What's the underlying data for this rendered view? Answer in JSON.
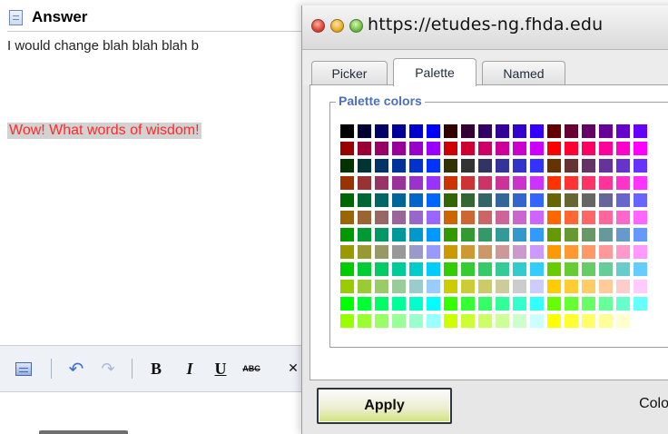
{
  "editor": {
    "title": "Answer",
    "text_line_1": "I would change blah blah blah b",
    "text_line_2": "Wow! What words of wisdom!",
    "toolbar": {
      "source_icon": "source-icon",
      "undo_icon": "undo-icon",
      "redo_icon": "redo-icon",
      "bold_label": "B",
      "italic_label": "I",
      "underline_label": "U",
      "strike_label": "ABC",
      "remove_label": "✕"
    }
  },
  "popup": {
    "url": "https://etudes-ng.fhda.edu",
    "tabs": [
      {
        "label": "Picker",
        "active": false
      },
      {
        "label": "Palette",
        "active": true
      },
      {
        "label": "Named",
        "active": false
      }
    ],
    "section_title": "Palette colors",
    "apply_label": "Apply",
    "color_label": "Colo"
  },
  "palette_colors": [
    [
      "#000000",
      "#000033",
      "#000066",
      "#000099",
      "#0000cc",
      "#0000ff",
      "#330000",
      "#330033",
      "#330066",
      "#330099",
      "#3300cc",
      "#3300ff",
      "#660000",
      "#660033",
      "#660066",
      "#660099",
      "#6600cc",
      "#6600ff"
    ],
    [
      "#990000",
      "#990033",
      "#990066",
      "#990099",
      "#9900cc",
      "#9900ff",
      "#cc0000",
      "#cc0033",
      "#cc0066",
      "#cc0099",
      "#cc00cc",
      "#cc00ff",
      "#ff0000",
      "#ff0033",
      "#ff0066",
      "#ff0099",
      "#ff00cc",
      "#ff00ff"
    ],
    [
      "#003300",
      "#003333",
      "#003366",
      "#003399",
      "#0033cc",
      "#0033ff",
      "#333300",
      "#333333",
      "#333366",
      "#333399",
      "#3333cc",
      "#3333ff",
      "#663300",
      "#663333",
      "#663366",
      "#663399",
      "#6633cc",
      "#6633ff"
    ],
    [
      "#993300",
      "#993333",
      "#993366",
      "#993399",
      "#9933cc",
      "#9933ff",
      "#cc3300",
      "#cc3333",
      "#cc3366",
      "#cc3399",
      "#cc33cc",
      "#cc33ff",
      "#ff3300",
      "#ff3333",
      "#ff3366",
      "#ff3399",
      "#ff33cc",
      "#ff33ff"
    ],
    [
      "#006600",
      "#006633",
      "#006666",
      "#006699",
      "#0066cc",
      "#0066ff",
      "#336600",
      "#336633",
      "#336666",
      "#336699",
      "#3366cc",
      "#3366ff",
      "#666600",
      "#666633",
      "#666666",
      "#666699",
      "#6666cc",
      "#6666ff"
    ],
    [
      "#996600",
      "#996633",
      "#996666",
      "#996699",
      "#9966cc",
      "#9966ff",
      "#cc6600",
      "#cc6633",
      "#cc6666",
      "#cc6699",
      "#cc66cc",
      "#cc66ff",
      "#ff6600",
      "#ff6633",
      "#ff6666",
      "#ff6699",
      "#ff66cc",
      "#ff66ff"
    ],
    [
      "#009900",
      "#009933",
      "#009966",
      "#009999",
      "#0099cc",
      "#0099ff",
      "#339900",
      "#339933",
      "#339966",
      "#339999",
      "#3399cc",
      "#3399ff",
      "#669900",
      "#669933",
      "#669966",
      "#669999",
      "#6699cc",
      "#6699ff"
    ],
    [
      "#999900",
      "#999933",
      "#999966",
      "#999999",
      "#9999cc",
      "#9999ff",
      "#cc9900",
      "#cc9933",
      "#cc9966",
      "#cc9999",
      "#cc99cc",
      "#cc99ff",
      "#ff9900",
      "#ff9933",
      "#ff9966",
      "#ff9999",
      "#ff99cc",
      "#ff99ff"
    ],
    [
      "#00cc00",
      "#00cc33",
      "#00cc66",
      "#00cc99",
      "#00cccc",
      "#00ccff",
      "#33cc00",
      "#33cc33",
      "#33cc66",
      "#33cc99",
      "#33cccc",
      "#33ccff",
      "#66cc00",
      "#66cc33",
      "#66cc66",
      "#66cc99",
      "#66cccc",
      "#66ccff"
    ],
    [
      "#99cc00",
      "#99cc33",
      "#99cc66",
      "#99cc99",
      "#99cccc",
      "#99ccff",
      "#cccc00",
      "#cccc33",
      "#cccc66",
      "#cccc99",
      "#cccccc",
      "#ccccff",
      "#ffcc00",
      "#ffcc33",
      "#ffcc66",
      "#ffcc99",
      "#ffcccc",
      "#ffccff"
    ],
    [
      "#00ff00",
      "#00ff33",
      "#00ff66",
      "#00ff99",
      "#00ffcc",
      "#00ffff",
      "#33ff00",
      "#33ff33",
      "#33ff66",
      "#33ff99",
      "#33ffcc",
      "#33ffff",
      "#66ff00",
      "#66ff33",
      "#66ff66",
      "#66ff99",
      "#66ffcc",
      "#66ffff"
    ],
    [
      "#99ff00",
      "#99ff33",
      "#99ff66",
      "#99ff99",
      "#99ffcc",
      "#99ffff",
      "#ccff00",
      "#ccff33",
      "#ccff66",
      "#ccff99",
      "#ccffcc",
      "#ccffff",
      "#ffff00",
      "#ffff33",
      "#ffff66",
      "#ffff99",
      "#ffffcc"
    ]
  ]
}
